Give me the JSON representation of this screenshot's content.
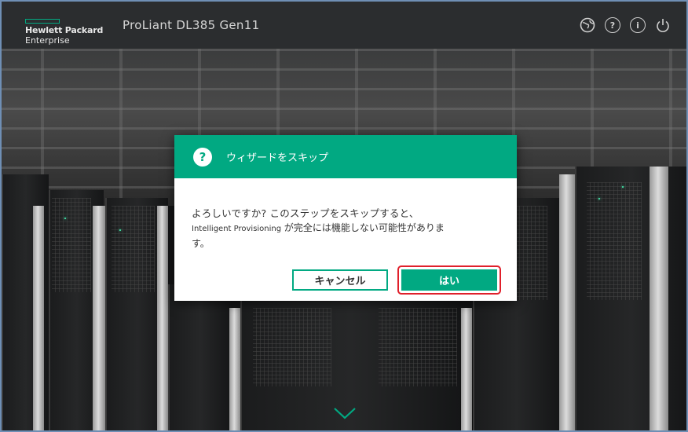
{
  "header": {
    "brand_line1": "Hewlett Packard",
    "brand_line2": "Enterprise",
    "product": "ProLiant DL385 Gen11",
    "icons": [
      "language-icon",
      "help-icon",
      "info-icon",
      "power-icon"
    ],
    "help_glyph": "?",
    "info_glyph": "i"
  },
  "dialog": {
    "icon_glyph": "?",
    "title": "ウィザードをスキップ",
    "message_line1": "よろしいですか? このステップをスキップすると、",
    "message_line2_latin": "Intelligent Provisioning",
    "message_line2_rest": " が完全には機能しない可能性がありま",
    "message_line3": "す。",
    "cancel_label": "キャンセル",
    "yes_label": "はい"
  },
  "colors": {
    "accent": "#01a982",
    "header_bg": "#2b2d2f",
    "highlight": "#e0202b"
  }
}
